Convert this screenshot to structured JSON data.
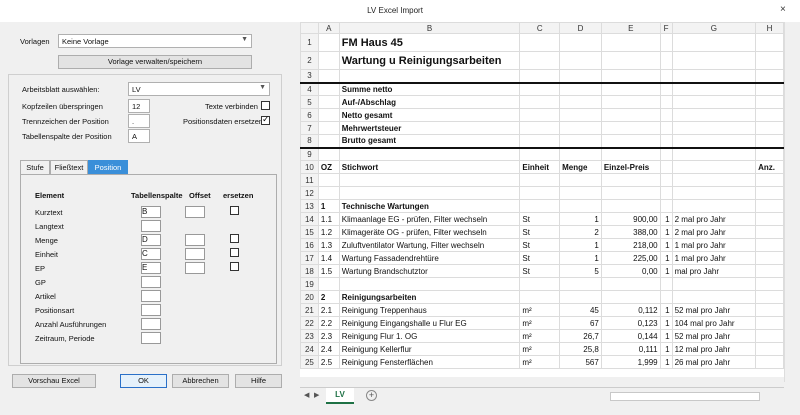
{
  "window": {
    "title": "LV Excel Import",
    "close_glyph": "×"
  },
  "left": {
    "vorlagen_label": "Vorlagen",
    "vorlagen_value": "Keine Vorlage",
    "manage_button": "Vorlage verwalten/speichern",
    "arbeitsblatt_label": "Arbeitsblatt auswählen:",
    "arbeitsblatt_value": "LV",
    "kopfzeilen_label": "Kopfzeilen überspringen",
    "kopfzeilen_value": "12",
    "texte_verbinden_label": "Texte verbinden",
    "trennzeichen_label": "Trennzeichen der Position",
    "trennzeichen_value": ".",
    "positionsdaten_label": "Positionsdaten ersetzen",
    "tabellenspalte_label": "Tabellenspalte der Position",
    "tabellenspalte_value": "A",
    "tabs": [
      "Stufe",
      "Fließtext",
      "Position"
    ],
    "table_headers": {
      "element": "Element",
      "spalte": "Tabellenspalte",
      "offset": "Offset",
      "ersetzen": "ersetzen"
    },
    "fields": [
      {
        "label": "Kurztext",
        "value": "B"
      },
      {
        "label": "Langtext",
        "value": ""
      },
      {
        "label": "Menge",
        "value": "D"
      },
      {
        "label": "Einheit",
        "value": "C"
      },
      {
        "label": "EP",
        "value": "E"
      },
      {
        "label": "GP",
        "value": ""
      },
      {
        "label": "Artikel",
        "value": ""
      },
      {
        "label": "Positionsart",
        "value": ""
      },
      {
        "label": "Anzahl Ausführungen",
        "value": ""
      },
      {
        "label": "Zeitraum, Periode",
        "value": ""
      }
    ],
    "buttons": {
      "preview": "Vorschau Excel",
      "ok": "OK",
      "cancel": "Abbrechen",
      "help": "Hilfe"
    }
  },
  "sheet": {
    "columns": [
      "",
      "A",
      "B",
      "C",
      "D",
      "E",
      "F",
      "G",
      "H"
    ],
    "rows": [
      [
        "1",
        "",
        "FM Haus 45",
        "",
        "",
        "",
        "",
        "",
        ""
      ],
      [
        "2",
        "",
        "Wartung u Reinigungsarbeiten",
        "",
        "",
        "",
        "",
        "",
        ""
      ],
      [
        "3",
        "",
        "",
        "",
        "",
        "",
        "",
        "",
        ""
      ],
      [
        "4",
        "",
        "Summe netto",
        "",
        "",
        "",
        "",
        "",
        ""
      ],
      [
        "5",
        "",
        "Auf-/Abschlag",
        "",
        "",
        "",
        "",
        "",
        ""
      ],
      [
        "6",
        "",
        "Netto gesamt",
        "",
        "",
        "",
        "",
        "",
        ""
      ],
      [
        "7",
        "",
        "Mehrwertsteuer",
        "",
        "",
        "",
        "",
        "",
        ""
      ],
      [
        "8",
        "",
        "Brutto gesamt",
        "",
        "",
        "",
        "",
        "",
        ""
      ],
      [
        "9",
        "",
        "",
        "",
        "",
        "",
        "",
        "",
        ""
      ],
      [
        "10",
        "OZ",
        "Stichwort",
        "Einheit",
        "Menge",
        "Einzel-Preis",
        "",
        "",
        "Anz."
      ],
      [
        "11",
        "",
        "",
        "",
        "",
        "",
        "",
        "",
        ""
      ],
      [
        "12",
        "",
        "",
        "",
        "",
        "",
        "",
        "",
        ""
      ],
      [
        "13",
        "1",
        "Technische Wartungen",
        "",
        "",
        "",
        "",
        "",
        ""
      ],
      [
        "14",
        "1.1",
        "Klimaanlage EG - prüfen, Filter wechseln",
        "St",
        "1",
        "900,00",
        "1",
        "2 mal pro Jahr",
        ""
      ],
      [
        "15",
        "1.2",
        "Klimageräte OG - prüfen, Filter wechseln",
        "St",
        "2",
        "388,00",
        "1",
        "2 mal pro Jahr",
        ""
      ],
      [
        "16",
        "1.3",
        "Zuluftventilator Wartung, Filter wechseln",
        "St",
        "1",
        "218,00",
        "1",
        "1 mal pro Jahr",
        ""
      ],
      [
        "17",
        "1.4",
        "Wartung Fassadendrehtüre",
        "St",
        "1",
        "225,00",
        "1",
        "1 mal pro Jahr",
        ""
      ],
      [
        "18",
        "1.5",
        "Wartung Brandschutztor",
        "St",
        "5",
        "0,00",
        "1",
        "mal pro Jahr",
        ""
      ],
      [
        "19",
        "",
        "",
        "",
        "",
        "",
        "",
        "",
        ""
      ],
      [
        "20",
        "2",
        "Reinigungsarbeiten",
        "",
        "",
        "",
        "",
        "",
        ""
      ],
      [
        "21",
        "2.1",
        "Reinigung Treppenhaus",
        "m²",
        "45",
        "0,112",
        "1",
        "52 mal pro Jahr",
        ""
      ],
      [
        "22",
        "2.2",
        "Reinigung Eingangshalle u Flur EG",
        "m²",
        "67",
        "0,123",
        "1",
        "104 mal pro Jahr",
        ""
      ],
      [
        "23",
        "2.3",
        "Reinigung Flur 1. OG",
        "m²",
        "26,7",
        "0,144",
        "1",
        "52 mal pro Jahr",
        ""
      ],
      [
        "24",
        "2.4",
        "Reinigung Kellerflur",
        "m²",
        "25,8",
        "0,111",
        "1",
        "12 mal pro Jahr",
        ""
      ],
      [
        "25",
        "2.5",
        "Reinigung Fensterflächen",
        "m²",
        "567",
        "1,999",
        "1",
        "26 mal pro Jahr",
        ""
      ]
    ],
    "sheet_tab": "LV",
    "add_glyph": "+",
    "nav_prev": "◀",
    "nav_next": "▶"
  }
}
